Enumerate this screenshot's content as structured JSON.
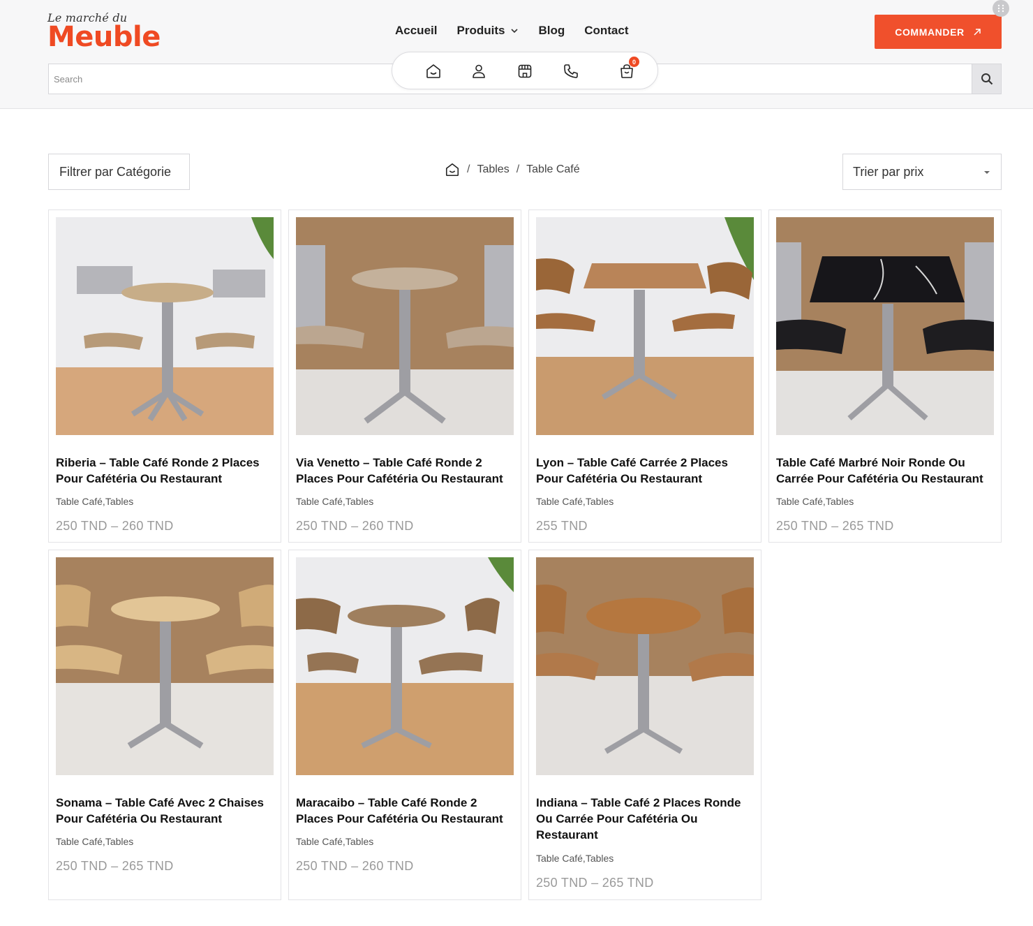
{
  "brand": {
    "small": "Le marché du",
    "big": "Meuble",
    "accent": "#ef4a23"
  },
  "nav": {
    "accueil": "Accueil",
    "produits": "Produits",
    "blog": "Blog",
    "contact": "Contact"
  },
  "cta": {
    "label": "COMMANDER",
    "icon": "arrow-up-right-icon",
    "color": "#f0502c"
  },
  "search": {
    "placeholder": "Search",
    "value": ""
  },
  "iconbar": {
    "icons": [
      "home-icon",
      "user-icon",
      "store-icon",
      "phone-icon",
      "cart-icon"
    ],
    "cart_count": "0"
  },
  "toolbar": {
    "filter_label": "Filtrer par Catégorie",
    "sort_label": "Trier par prix"
  },
  "breadcrumb": {
    "items": [
      "Tables",
      "Table Café"
    ]
  },
  "products": [
    {
      "title": "Riberia – Table Café Ronde 2 Places Pour Cafétéria Ou Restaurant",
      "categories": "Table Café,Tables",
      "price": "250 TND  –  260 TND"
    },
    {
      "title": "Via Venetto – Table Café Ronde 2 Places Pour Cafétéria Ou Restaurant",
      "categories": "Table Café,Tables",
      "price": "250 TND  –  260 TND"
    },
    {
      "title": "Lyon – Table Café Carrée 2 Places Pour Cafétéria Ou Restaurant",
      "categories": "Table Café,Tables",
      "price": "255 TND"
    },
    {
      "title": "Table Café Marbré Noir Ronde Ou Carrée Pour Cafétéria Ou Restaurant",
      "categories": "Table Café,Tables",
      "price": "250 TND  –  265 TND"
    },
    {
      "title": "Sonama – Table Café Avec 2 Chaises Pour Cafétéria Ou Restaurant",
      "categories": "Table Café,Tables",
      "price": "250 TND  –  265 TND"
    },
    {
      "title": "Maracaibo – Table Café Ronde 2 Places Pour Cafétéria Ou Restaurant",
      "categories": "Table Café,Tables",
      "price": "250 TND  –  260 TND"
    },
    {
      "title": "Indiana – Table Café 2 Places Ronde Ou Carrée Pour Cafétéria Ou Restaurant",
      "categories": "Table Café,Tables",
      "price": "250 TND  –  265 TND"
    }
  ]
}
